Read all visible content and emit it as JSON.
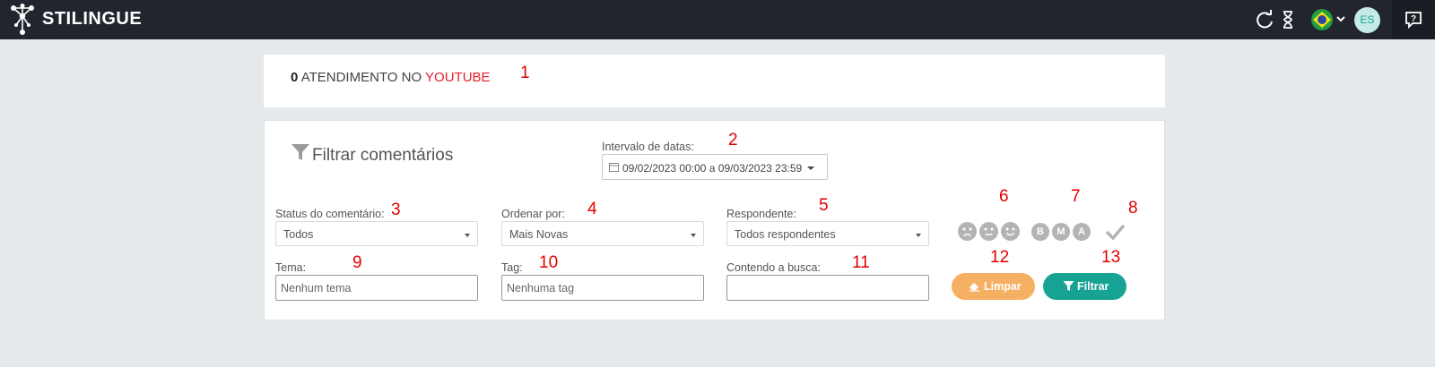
{
  "header": {
    "brand": "STILINGUE",
    "avatar_initials": "ES",
    "icons": [
      "logo-icon",
      "refresh-icon",
      "hourglass-icon",
      "brazil-flag-icon",
      "chevron-down-icon",
      "help-icon"
    ],
    "colors": {
      "bar": "#22252e",
      "accent": "#17a393"
    }
  },
  "summary": {
    "count": "0",
    "text": "ATENDIMENTO NO",
    "channel": "YOUTUBE"
  },
  "filters": {
    "title": "Filtrar comentários",
    "date_range": {
      "label": "Intervalo de datas:",
      "value": "09/02/2023 00:00 a 09/03/2023 23:59"
    },
    "status": {
      "label": "Status do comentário:",
      "value": "Todos"
    },
    "order": {
      "label": "Ordenar por:",
      "value": "Mais Novas"
    },
    "respondent": {
      "label": "Respondente:",
      "value": "Todos respondentes"
    },
    "theme": {
      "label": "Tema:",
      "placeholder": "Nenhum tema"
    },
    "tag": {
      "label": "Tag:",
      "placeholder": "Nenhuma tag"
    },
    "search": {
      "label": "Contendo a busca:",
      "placeholder": ""
    },
    "sentiment_icons": [
      "negative-face-icon",
      "neutral-face-icon",
      "positive-face-icon"
    ],
    "quality_letters": [
      "B",
      "M",
      "A"
    ],
    "clear_label": "Limpar",
    "filter_label": "Filtrar",
    "colors": {
      "clear": "#f6b064",
      "filter": "#17a393"
    }
  },
  "annotations": [
    "1",
    "2",
    "3",
    "4",
    "5",
    "6",
    "7",
    "8",
    "9",
    "10",
    "11",
    "12",
    "13"
  ]
}
